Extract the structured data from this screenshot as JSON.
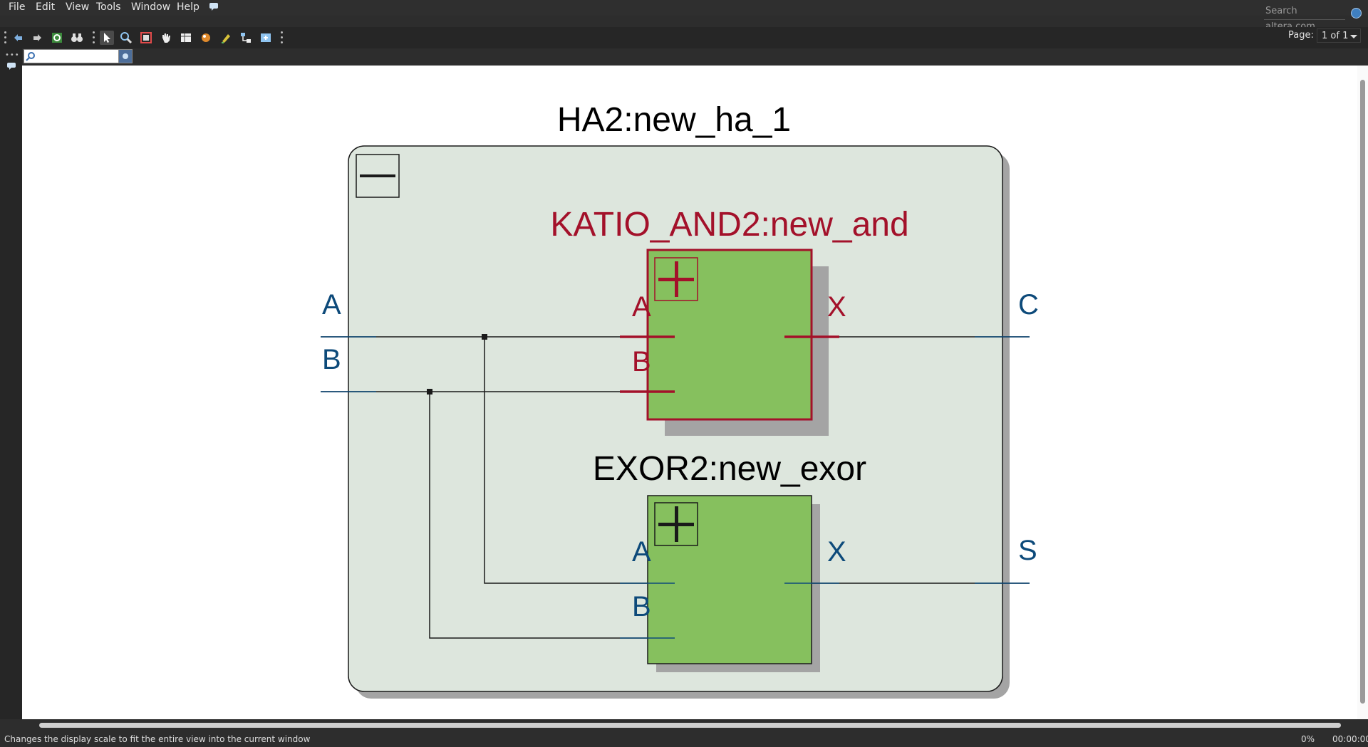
{
  "menu": [
    "File",
    "Edit",
    "View",
    "Tools",
    "Window",
    "Help"
  ],
  "search": {
    "placeholder": "Search altera.com"
  },
  "toolbar": {
    "page_label": "Page:",
    "page_value": "1 of 1",
    "tools": [
      "back-icon",
      "forward-icon",
      "refresh-icon",
      "binoculars-icon",
      "select-pointer-icon",
      "zoom-icon",
      "fit-window-icon",
      "pan-hand-icon",
      "netlist-table-icon",
      "color-icon",
      "highlight-icon",
      "hierarchy-icon",
      "export-icon"
    ]
  },
  "schematic": {
    "parent_title": "HA2:new_ha_1",
    "parent_inputs": [
      "A",
      "B"
    ],
    "parent_outputs": [
      "C",
      "S"
    ],
    "blocks": [
      {
        "title": "KATIO_AND2:new_and",
        "in_a": "A",
        "in_b": "B",
        "out_x": "X",
        "state": "highlighted"
      },
      {
        "title": "EXOR2:new_exor",
        "in_a": "A",
        "in_b": "B",
        "out_x": "X",
        "state": "normal"
      }
    ]
  },
  "colors": {
    "highlight": "#a3112a",
    "port_blue": "#0d4a7a",
    "block_fill": "#86c05e",
    "parent_fill": "#dde6dd",
    "wire": "#1a1a1a"
  },
  "status": {
    "message": "Changes the display scale to fit the entire view into the current window",
    "percent": "0%",
    "time": "00:00:00"
  }
}
